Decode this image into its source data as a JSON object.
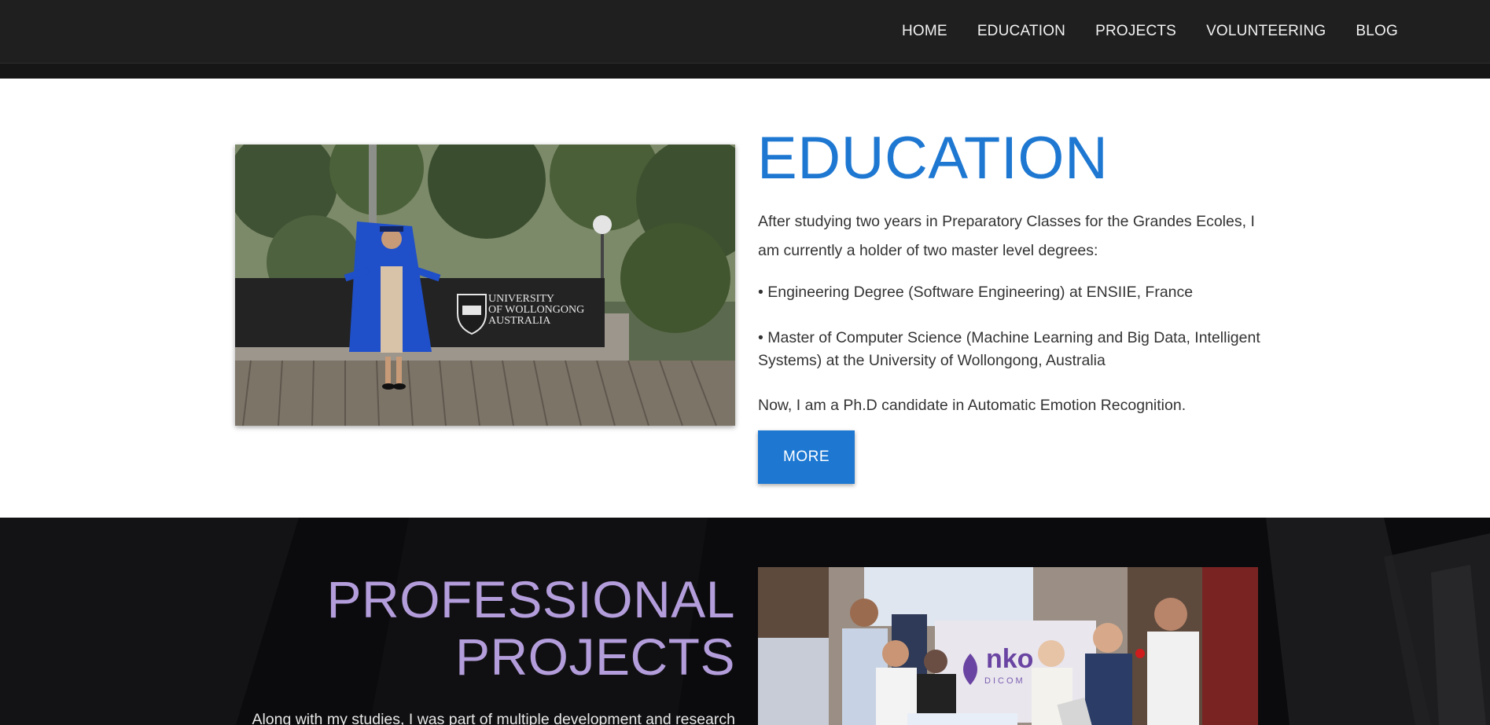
{
  "nav": {
    "items": [
      {
        "label": "HOME"
      },
      {
        "label": "EDUCATION"
      },
      {
        "label": "PROJECTS"
      },
      {
        "label": "VOLUNTEERING"
      },
      {
        "label": "BLOG"
      }
    ]
  },
  "education": {
    "title": "EDUCATION",
    "intro": "After studying two years in Preparatory Classes for the Grandes Ecoles, I am currently a holder of two master level degrees:",
    "degrees": [
      "•  Engineering Degree (Software Engineering) at ENSIIE, France",
      "•  Master of Computer Science (Machine Learning and Big Data, Intelligent Systems) at the University of Wollongong, Australia"
    ],
    "outro": "Now, I am a Ph.D candidate in Automatic Emotion Recognition.",
    "more_label": "MORE",
    "photo": {
      "sign_line1": "UNIVERSITY",
      "sign_line2": "OF WOLLONGONG",
      "sign_line3": "AUSTRALIA"
    }
  },
  "projects": {
    "title_line1": "PROFESSIONAL",
    "title_line2": "PROJECTS",
    "intro": "Along with my studies, I was part of multiple development and research",
    "photo": {
      "banner_text": "nko",
      "banner_sub": "DICOM"
    }
  },
  "colors": {
    "nav_bg": "#1f1f1f",
    "accent_blue": "#1e78d2",
    "projects_title": "#b39ddb",
    "projects_bg": "#0b0b0d"
  }
}
